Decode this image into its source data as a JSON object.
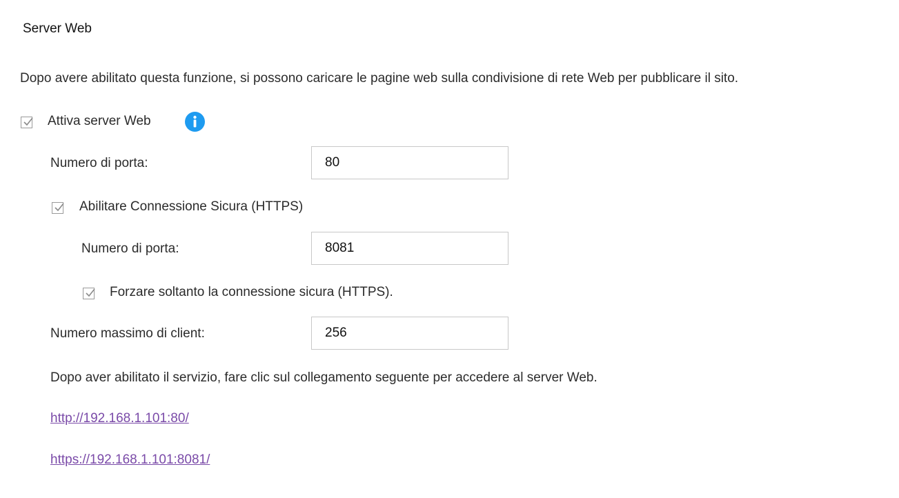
{
  "section": {
    "title": "Server Web",
    "description": "Dopo avere abilitato questa funzione, si possono caricare le pagine web sulla condivisione di rete Web per pubblicare il sito."
  },
  "web_server": {
    "enable_label": "Attiva server Web",
    "enabled": true,
    "info_icon": "info-icon",
    "port_label": "Numero di porta:",
    "port_value": "80"
  },
  "https": {
    "enable_label": "Abilitare Connessione Sicura (HTTPS)",
    "enabled": true,
    "port_label": "Numero di porta:",
    "port_value": "8081",
    "force_label": "Forzare soltanto la connessione sicura (HTTPS).",
    "force_enabled": true
  },
  "clients": {
    "label": "Numero massimo di client:",
    "value": "256"
  },
  "links": {
    "intro": "Dopo aver abilitato il servizio, fare clic sul collegamento seguente per accedere al server Web.",
    "http_url": "http://192.168.1.101:80/",
    "https_url": "https://192.168.1.101:8081/"
  },
  "colors": {
    "accent": "#1e9bf0",
    "link": "#7a4aa8",
    "checkmark": "#8a8a8a"
  }
}
